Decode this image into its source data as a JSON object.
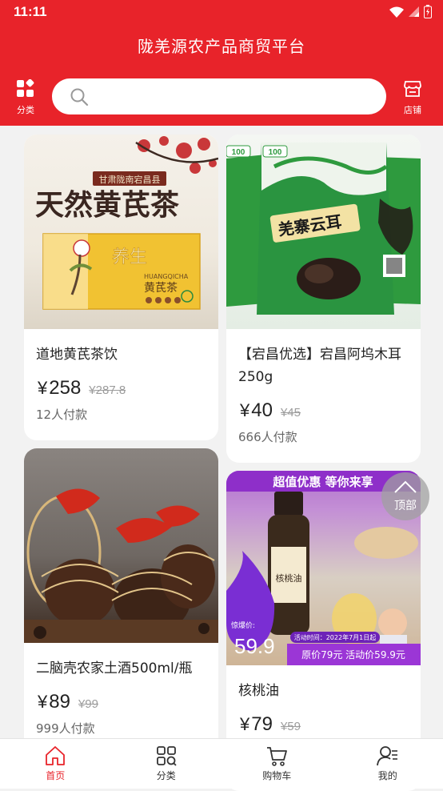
{
  "status_bar": {
    "time": "11:11"
  },
  "header": {
    "title": "陇羌源农产品商贸平台",
    "left_button_label": "分类",
    "right_button_label": "店铺",
    "search_placeholder": ""
  },
  "products": [
    {
      "name": "道地黄芪茶饮",
      "price": "258",
      "original_price": "¥287.8",
      "buyers": "12人付款",
      "currency": "¥",
      "image_text": {
        "big": "天然黄芪茶",
        "tag": "甘肃陇南宕昌县",
        "box_big": "养生",
        "box_small": "黄芪茶",
        "box_en": "HUANGQICHA"
      }
    },
    {
      "name": "【宕昌优选】宕昌阿坞木耳250g",
      "price": "40",
      "original_price": "¥45",
      "buyers": "666人付款",
      "currency": "¥",
      "image_text": {
        "bag": "羌寨云耳",
        "badge": "100"
      }
    },
    {
      "name": "二脑壳农家土酒500ml/瓶",
      "price": "89",
      "original_price": "¥99",
      "buyers": "999人付款",
      "currency": "¥"
    },
    {
      "name": "核桃油",
      "price": "79",
      "original_price": "¥59",
      "buyers": "",
      "currency": "¥",
      "image_text": {
        "banner": "超值优惠 等你来享",
        "flame_label": "惊爆价:",
        "flame_price": "59.9",
        "activity_time": "活动时间：2022年7月1日起",
        "promo": "原价79元 活动价59.9元",
        "bottle": "核桃油"
      }
    }
  ],
  "back_to_top_label": "顶部",
  "tabs": [
    {
      "label": "首页",
      "active": true
    },
    {
      "label": "分类",
      "active": false
    },
    {
      "label": "购物车",
      "active": false
    },
    {
      "label": "我的",
      "active": false
    }
  ],
  "colors": {
    "primary": "#e8232a",
    "background": "#f2f2f2"
  }
}
